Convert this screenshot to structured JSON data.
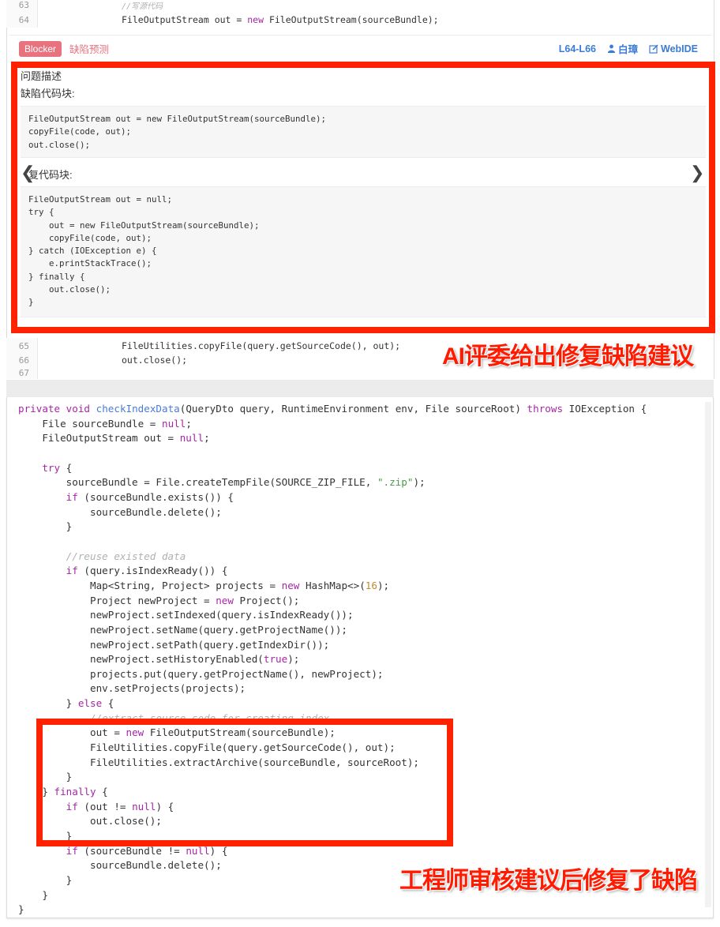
{
  "top_code": {
    "lines": [
      {
        "num": "63",
        "text": "//写源代码"
      },
      {
        "num": "64",
        "pre": "FileOutputStream out = ",
        "kw": "new",
        "post": " FileOutputStream(sourceBundle);"
      }
    ]
  },
  "issue": {
    "severity_badge": "Blocker",
    "type_label": "缺陷预测",
    "line_range": "L64-L66",
    "assignee": "白璋",
    "webide_label": "WebIDE",
    "description_title": "问题描述",
    "defect_block_title": "缺陷代码块:",
    "defect_code": "FileOutputStream out = new FileOutputStream(sourceBundle);\ncopyFile(code, out);\nout.close();",
    "fix_block_title": "修复代码块:",
    "fix_block_title_visible": "复代码块:",
    "fix_code": "FileOutputStream out = null;\ntry {\n    out = new FileOutputStream(sourceBundle);\n    copyFile(code, out);\n} catch (IOException e) {\n    e.printStackTrace();\n} finally {\n    out.close();\n}",
    "prev_arrow": "❮",
    "next_arrow": "❯"
  },
  "after_code": {
    "lines": [
      {
        "num": "65",
        "text": "FileUtilities.copyFile(query.getSourceCode(), out);"
      },
      {
        "num": "66",
        "text": "out.close();"
      },
      {
        "num": "67",
        "text": ""
      }
    ]
  },
  "annotations": {
    "ai_suggestion": "AI评委给出修复缺陷建议",
    "engineer_fix": "工程师审核建议后修复了缺陷"
  },
  "fixed_code": {
    "lines": [
      "private void checkIndexData(QueryDto query, RuntimeEnvironment env, File sourceRoot) throws IOException {",
      "    File sourceBundle = null;",
      "    FileOutputStream out = null;",
      "",
      "    try {",
      "        sourceBundle = File.createTempFile(SOURCE_ZIP_FILE, \".zip\");",
      "        if (sourceBundle.exists()) {",
      "            sourceBundle.delete();",
      "        }",
      "",
      "        //reuse existed data",
      "        if (query.isIndexReady()) {",
      "            Map<String, Project> projects = new HashMap<>(16);",
      "            Project newProject = new Project();",
      "            newProject.setIndexed(query.isIndexReady());",
      "            newProject.setName(query.getProjectName());",
      "            newProject.setPath(query.getIndexDir());",
      "            newProject.setHistoryEnabled(true);",
      "            projects.put(query.getProjectName(), newProject);",
      "            env.setProjects(projects);",
      "        } else {",
      "            //extract source code for creating index",
      "            out = new FileOutputStream(sourceBundle);",
      "            FileUtilities.copyFile(query.getSourceCode(), out);",
      "            FileUtilities.extractArchive(sourceBundle, sourceRoot);",
      "        }",
      "    } finally {",
      "        if (out != null) {",
      "            out.close();",
      "        }",
      "        if (sourceBundle != null) {",
      "            sourceBundle.delete();",
      "        }",
      "    }",
      "}"
    ]
  },
  "colors": {
    "highlight_red": "#ff2200",
    "badge": "#e8737f",
    "link_blue": "#3a7bd5",
    "keyword": "#a626a4"
  }
}
